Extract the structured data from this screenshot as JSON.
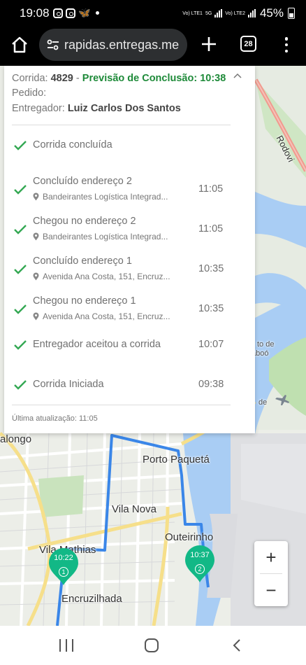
{
  "status_bar": {
    "time": "19:08",
    "net1": "Vo) LTE1",
    "net_mid": "5G",
    "net2": "Vo) LTE2",
    "battery": "45%"
  },
  "browser": {
    "url": "rapidas.entregas.me",
    "tab_count": "28"
  },
  "panel": {
    "corrida_label": "Corrida:",
    "corrida_number": "4829",
    "separator": "-",
    "previsao_label": "Previsão de Conclusão:",
    "previsao_time": "10:38",
    "pedido_label": "Pedido:",
    "entregador_label": "Entregador:",
    "entregador_name": "Luiz Carlos Dos Santos",
    "events": [
      {
        "label": "Corrida concluída",
        "address": "",
        "time": ""
      },
      {
        "label": "Concluído endereço 2",
        "address": "Bandeirantes Logística Integrad...",
        "time": "11:05"
      },
      {
        "label": "Chegou no endereço 2",
        "address": "Bandeirantes Logística Integrad...",
        "time": "11:05"
      },
      {
        "label": "Concluído endereço 1",
        "address": "Avenida Ana Costa, 151, Encruz...",
        "time": "10:35"
      },
      {
        "label": "Chegou no endereço 1",
        "address": "Avenida Ana Costa, 151, Encruz...",
        "time": "10:35"
      },
      {
        "label": "Entregador aceitou a corrida",
        "address": "",
        "time": "10:07"
      },
      {
        "label": "Corrida Iniciada",
        "address": "",
        "time": "09:38"
      }
    ],
    "last_update": "Última atualização: 11:05"
  },
  "map": {
    "labels": {
      "rodovia": "Rodovi",
      "valongo": "alongo",
      "porto_paqueta": "Porto Paquetá",
      "vila_nova": "Vila Nova",
      "outeirinho": "Outeirinho",
      "vila_mathias": "Vila Mathias",
      "encruzilhada": "Encruzilhada",
      "porto_de": "to de",
      "saboo": "aboó",
      "de": "de"
    },
    "pins": [
      {
        "time": "10:22",
        "number": "1"
      },
      {
        "time": "10:37",
        "number": "2"
      }
    ],
    "zoom_in": "+",
    "zoom_out": "−",
    "colors": {
      "route": "#3a86e8",
      "pin": "#12b886",
      "water": "#a9cdf4",
      "green_check": "#34a853"
    }
  }
}
